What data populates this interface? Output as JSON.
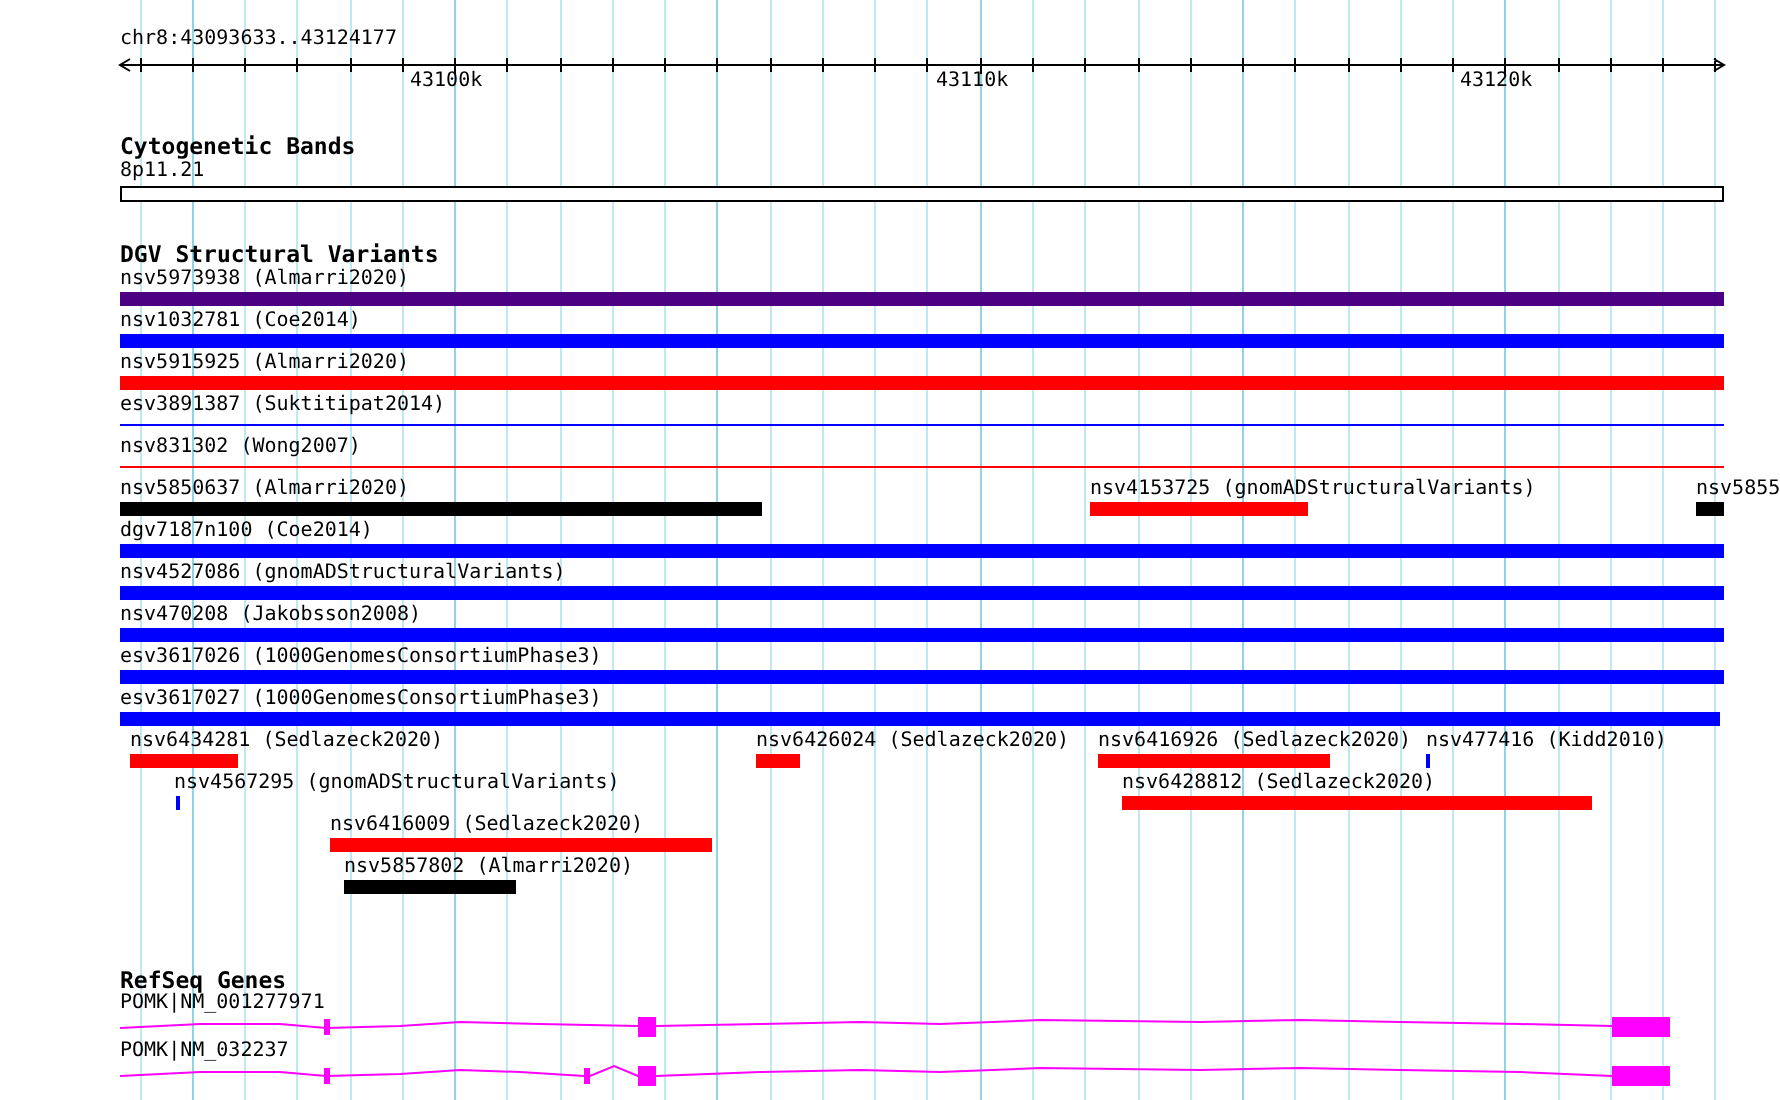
{
  "ruler": {
    "location": "chr8:43093633..43124177",
    "ticks": [
      "43100k",
      "43110k",
      "43120k"
    ]
  },
  "tracks": [
    {
      "kind": "bands",
      "title": "Cytogenetic Bands",
      "features": [
        {
          "label": "8p11.21"
        }
      ]
    },
    {
      "kind": "variants",
      "title": "DGV Structural Variants",
      "features": [
        {
          "label": "nsv5973938 (Almarri2020)",
          "kind": "bar",
          "color": "#4b0082"
        },
        {
          "label": "nsv1032781 (Coe2014)",
          "kind": "bar",
          "color": "#0000ff"
        },
        {
          "label": "nsv5915925 (Almarri2020)",
          "kind": "bar",
          "color": "#ff0000"
        },
        {
          "label": "esv3891387 (Suktitipat2014)",
          "kind": "line",
          "color": "#0000ff"
        },
        {
          "label": "nsv831302 (Wong2007)",
          "kind": "line",
          "color": "#ff0000"
        },
        {
          "label": "nsv5850637 (Almarri2020)",
          "kind": "bar",
          "color": "#000000"
        },
        {
          "label": "nsv4153725 (gnomADStructuralVariants)",
          "kind": "bar",
          "color": "#ff0000"
        },
        {
          "label": "nsv5855",
          "kind": "bar",
          "color": "#000000"
        },
        {
          "label": "dgv7187n100 (Coe2014)",
          "kind": "bar",
          "color": "#0000ff"
        },
        {
          "label": "nsv4527086 (gnomADStructuralVariants)",
          "kind": "bar",
          "color": "#0000ff"
        },
        {
          "label": "nsv470208 (Jakobsson2008)",
          "kind": "bar",
          "color": "#0000ff"
        },
        {
          "label": "esv3617026 (1000GenomesConsortiumPhase3)",
          "kind": "bar",
          "color": "#0000ff"
        },
        {
          "label": "esv3617027 (1000GenomesConsortiumPhase3)",
          "kind": "bar",
          "color": "#0000ff"
        },
        {
          "label": "nsv6434281 (Sedlazeck2020)",
          "kind": "bar",
          "color": "#ff0000"
        },
        {
          "label": "nsv6426024 (Sedlazeck2020)",
          "kind": "bar",
          "color": "#ff0000"
        },
        {
          "label": "nsv6416926 (Sedlazeck2020)",
          "kind": "bar",
          "color": "#ff0000"
        },
        {
          "label": "nsv477416 (Kidd2010)",
          "kind": "bar",
          "color": "#0000ff"
        },
        {
          "label": "nsv4567295 (gnomADStructuralVariants)",
          "kind": "bar",
          "color": "#0000ff"
        },
        {
          "label": "nsv6428812 (Sedlazeck2020)",
          "kind": "bar",
          "color": "#ff0000"
        },
        {
          "label": "nsv6416009 (Sedlazeck2020)",
          "kind": "bar",
          "color": "#ff0000"
        },
        {
          "label": "nsv5857802 (Almarri2020)",
          "kind": "bar",
          "color": "#000000"
        }
      ]
    },
    {
      "kind": "genes",
      "title": "RefSeq Genes",
      "features": [
        {
          "label": "POMK|NM_001277971"
        },
        {
          "label": "POMK|NM_032237"
        }
      ]
    }
  ]
}
